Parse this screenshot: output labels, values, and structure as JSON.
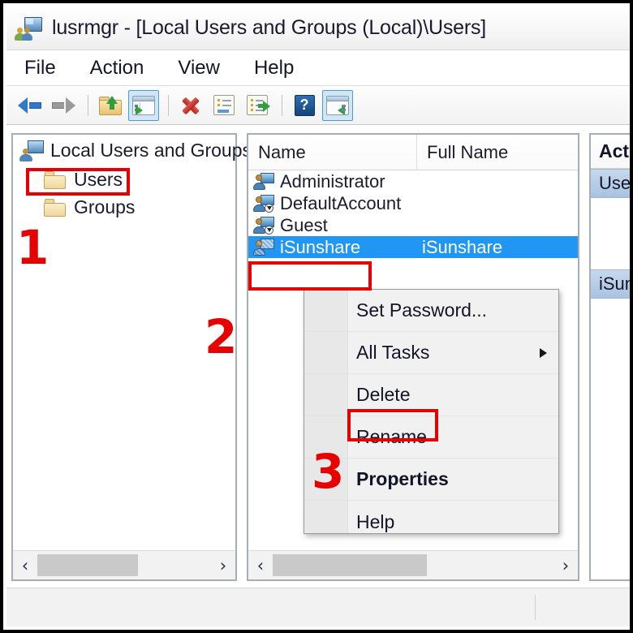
{
  "window": {
    "title": "lusrmgr - [Local Users and Groups (Local)\\Users]",
    "icon": "mmc-users-icon",
    "accent_selection": "#2196f3",
    "annotation_color": "#e60000"
  },
  "menubar": {
    "items": [
      {
        "label": "File"
      },
      {
        "label": "Action"
      },
      {
        "label": "View"
      },
      {
        "label": "Help"
      }
    ]
  },
  "toolbar": {
    "buttons": [
      {
        "name": "back-button",
        "icon": "back-arrow-icon",
        "selected": false
      },
      {
        "name": "forward-button",
        "icon": "forward-arrow-icon",
        "selected": false
      },
      {
        "name": "up-one-level-button",
        "icon": "folder-up-icon",
        "selected": false
      },
      {
        "name": "show-hide-console-tree-button",
        "icon": "console-tree-icon",
        "selected": true
      },
      {
        "name": "delete-button",
        "icon": "red-x-icon",
        "selected": false
      },
      {
        "name": "export-list-button",
        "icon": "save-list-icon",
        "selected": false
      },
      {
        "name": "new-item-button",
        "icon": "export-doc-icon",
        "selected": false
      },
      {
        "name": "help-button",
        "icon": "help-question-icon",
        "selected": false
      },
      {
        "name": "show-hide-action-pane-button",
        "icon": "action-pane-icon",
        "selected": true
      }
    ]
  },
  "tree": {
    "root": {
      "label": "Local Users and Groups",
      "icon": "mmc-computer-users-icon"
    },
    "nodes": [
      {
        "label": "Users",
        "icon": "folder-icon",
        "selected": true
      },
      {
        "label": "Groups",
        "icon": "folder-icon",
        "selected": false
      }
    ]
  },
  "list": {
    "columns": [
      "Name",
      "Full Name"
    ],
    "rows": [
      {
        "name": "Administrator",
        "full_name": "",
        "icon": "user-account-icon",
        "selected": false
      },
      {
        "name": "DefaultAccount",
        "full_name": "",
        "icon": "user-account-disabled-icon",
        "selected": false
      },
      {
        "name": "Guest",
        "full_name": "",
        "icon": "user-account-disabled-icon",
        "selected": false
      },
      {
        "name": "iSunshare",
        "full_name": "iSunshare",
        "icon": "user-account-icon",
        "selected": true
      }
    ]
  },
  "actions_pane": {
    "header": "Actions",
    "group_users": "Users",
    "group_item": "iSunshare"
  },
  "context_menu": {
    "items": [
      {
        "label": "Set Password...",
        "bold": false,
        "submenu": false,
        "separator_after": true
      },
      {
        "label": "All Tasks",
        "bold": false,
        "submenu": true,
        "separator_after": true
      },
      {
        "label": "Delete",
        "bold": false,
        "submenu": false,
        "separator_after": false
      },
      {
        "label": "Rename",
        "bold": false,
        "submenu": false,
        "separator_after": true
      },
      {
        "label": "Properties",
        "bold": true,
        "submenu": false,
        "separator_after": true
      },
      {
        "label": "Help",
        "bold": false,
        "submenu": false,
        "separator_after": false
      }
    ]
  },
  "scrollbars": {
    "left_arrow": "‹",
    "right_arrow": "›"
  },
  "annotations": {
    "step1": "1",
    "step2": "2",
    "step3": "3",
    "highlight_users": "Users",
    "highlight_user_row": "iSunshare",
    "highlight_rename": "Rename"
  }
}
